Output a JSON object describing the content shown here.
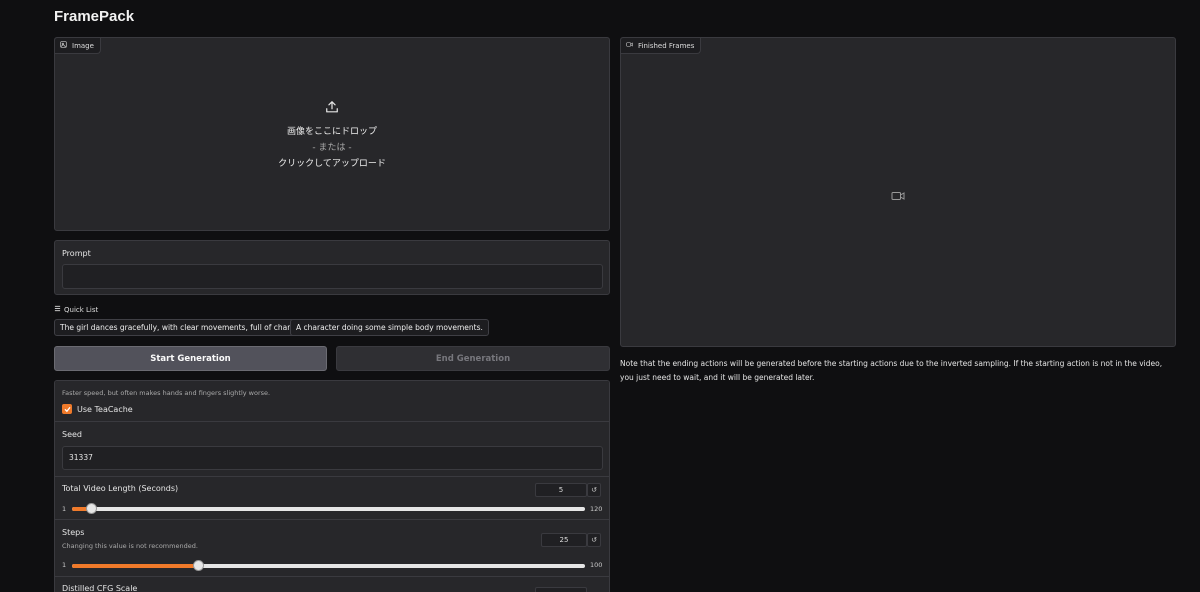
{
  "app": {
    "title": "FramePack"
  },
  "image_panel": {
    "label": "Image",
    "upload_line1": "画像をここにドロップ",
    "upload_line2": "- または -",
    "upload_line3": "クリックしてアップロード"
  },
  "video_panel": {
    "label": "Finished Frames"
  },
  "prompt": {
    "label": "Prompt",
    "value": "",
    "placeholder": ""
  },
  "quick_list": {
    "label": "Quick List",
    "items": [
      "The girl dances gracefully, with clear movements, full of charm.",
      "A character doing some simple body movements."
    ]
  },
  "buttons": {
    "start": "Start Generation",
    "end": "End Generation"
  },
  "teacache": {
    "info": "Faster speed, but often makes hands and fingers slightly worse.",
    "label": "Use TeaCache",
    "checked": true
  },
  "seed": {
    "label": "Seed",
    "value": "31337"
  },
  "video_length": {
    "label": "Total Video Length (Seconds)",
    "value": "5",
    "min": "1",
    "max": "120",
    "fraction": 0.034
  },
  "steps": {
    "label": "Steps",
    "info": "Changing this value is not recommended.",
    "value": "25",
    "min": "1",
    "max": "100",
    "fraction": 0.242
  },
  "cfg": {
    "label": "Distilled CFG Scale"
  },
  "note": "Note that the ending actions will be generated before the starting actions due to the inverted sampling. If the starting action is not in the video, you just need to wait, and it will be generated later.",
  "colors": {
    "accent": "#f07a2a",
    "panel": "#27272a",
    "background": "#0f0f11"
  }
}
